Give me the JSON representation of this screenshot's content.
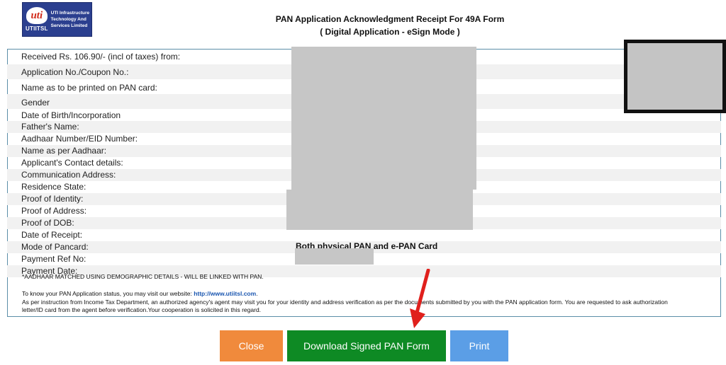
{
  "logo": {
    "mark": "uti",
    "sub": "UTIITSL",
    "lines": [
      "UTI  Infrastructure",
      "Technology   And",
      "Services    Limited"
    ]
  },
  "header": {
    "title": "PAN Application Acknowledgment Receipt For 49A Form",
    "subtitle": "( Digital Application - eSign Mode )"
  },
  "fields": [
    {
      "label": "Received Rs. 106.90/- (incl of taxes) from:",
      "value": ""
    },
    {
      "label": "Application No./Coupon No.:",
      "value": ""
    },
    {
      "label": "Name as to be printed on PAN card:",
      "value": ""
    },
    {
      "label": "Gender",
      "value": ""
    },
    {
      "label": "Date of Birth/Incorporation",
      "value": ""
    },
    {
      "label": "Father's Name:",
      "value": ""
    },
    {
      "label": "Aadhaar Number/EID Number:",
      "value": ""
    },
    {
      "label": "Name as per Aadhaar:",
      "value": ""
    },
    {
      "label": "Applicant's Contact details:",
      "value": ""
    },
    {
      "label": "Communication Address:",
      "value": ""
    },
    {
      "label": "Residence State:",
      "value": ""
    },
    {
      "label": "Proof of Identity:",
      "value": ""
    },
    {
      "label": "Proof of Address:",
      "value": ""
    },
    {
      "label": "Proof of DOB:",
      "value": ""
    },
    {
      "label": "Date of Receipt:",
      "value": ""
    },
    {
      "label": "Mode of Pancard:",
      "value": "Both physical PAN and e-PAN Card"
    },
    {
      "label": "Payment Ref No:",
      "value": ""
    },
    {
      "label": "Payment Date:",
      "value": ""
    }
  ],
  "notes": {
    "aadhaar": "*AADHAAR MATCHED USING DEMOGRAPHIC DETAILS - WILL BE LINKED WITH PAN.",
    "status_prefix": "To know your PAN Application status, you may visit our website: ",
    "status_link": "http://www.utiitsl.com",
    "status_suffix": ".",
    "agent_line1": "As per instruction from Income Tax Department, an authorized agency's agent may visit you for your identity and address verification as per the documents submitted by you with the PAN application form. You are requested to ask authorization",
    "agent_line2": "letter/ID card from the agent before verification.Your cooperation is solicited in this regard."
  },
  "buttons": {
    "close": "Close",
    "download": "Download Signed PAN Form",
    "print": "Print"
  },
  "colors": {
    "close": "#f08a3c",
    "download": "#0e8a24",
    "print": "#5b9ee6",
    "arrow": "#e0201c"
  }
}
